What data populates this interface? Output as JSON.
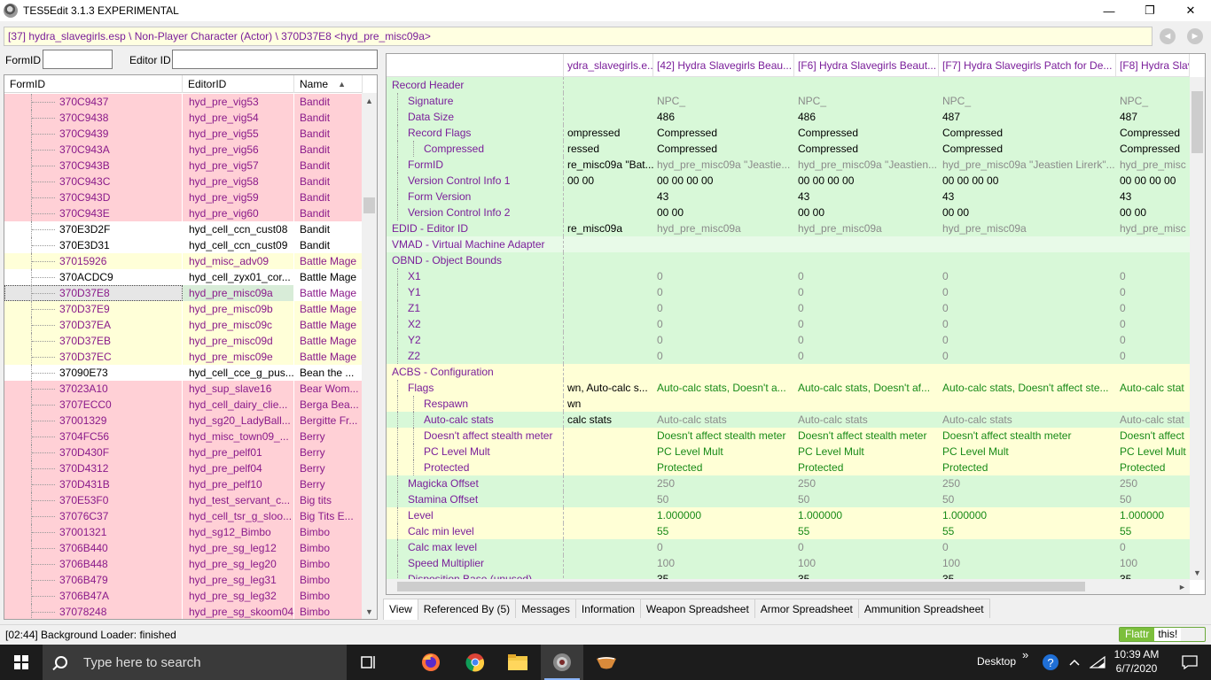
{
  "window": {
    "title": "TES5Edit 3.1.3 EXPERIMENTAL",
    "minimize": "—",
    "restore": "❐",
    "close": "✕"
  },
  "path": "[37] hydra_slavegirls.esp \\ Non-Player Character (Actor) \\ 370D37E8 <hyd_pre_misc09a>",
  "nav": {
    "back": "◄",
    "forward": "►"
  },
  "filter": {
    "formid_label": "FormID",
    "editorid_label": "Editor ID",
    "formid_value": "",
    "editorid_value": ""
  },
  "left_list": {
    "headers": [
      "FormID",
      "EditorID",
      "Name"
    ],
    "sort_indicator": "▲",
    "rows": [
      {
        "formid": "370C9437",
        "editorid": "hyd_pre_vig53",
        "name": "Bandit",
        "color": "pink"
      },
      {
        "formid": "370C9438",
        "editorid": "hyd_pre_vig54",
        "name": "Bandit",
        "color": "pink"
      },
      {
        "formid": "370C9439",
        "editorid": "hyd_pre_vig55",
        "name": "Bandit",
        "color": "pink"
      },
      {
        "formid": "370C943A",
        "editorid": "hyd_pre_vig56",
        "name": "Bandit",
        "color": "pink"
      },
      {
        "formid": "370C943B",
        "editorid": "hyd_pre_vig57",
        "name": "Bandit",
        "color": "pink"
      },
      {
        "formid": "370C943C",
        "editorid": "hyd_pre_vig58",
        "name": "Bandit",
        "color": "pink"
      },
      {
        "formid": "370C943D",
        "editorid": "hyd_pre_vig59",
        "name": "Bandit",
        "color": "pink"
      },
      {
        "formid": "370C943E",
        "editorid": "hyd_pre_vig60",
        "name": "Bandit",
        "color": "pink"
      },
      {
        "formid": "370E3D2F",
        "editorid": "hyd_cell_ccn_cust08",
        "name": "Bandit",
        "color": "white"
      },
      {
        "formid": "370E3D31",
        "editorid": "hyd_cell_ccn_cust09",
        "name": "Bandit",
        "color": "white"
      },
      {
        "formid": "37015926",
        "editorid": "hyd_misc_adv09",
        "name": "Battle Mage",
        "color": "yellow"
      },
      {
        "formid": "370ACDC9",
        "editorid": "hyd_cell_zyx01_cor...",
        "name": "Battle Mage",
        "color": "white"
      },
      {
        "formid": "370D37E8",
        "editorid": "hyd_pre_misc09a",
        "name": "Battle Mage",
        "color": "selected"
      },
      {
        "formid": "370D37E9",
        "editorid": "hyd_pre_misc09b",
        "name": "Battle Mage",
        "color": "yellow"
      },
      {
        "formid": "370D37EA",
        "editorid": "hyd_pre_misc09c",
        "name": "Battle Mage",
        "color": "yellow"
      },
      {
        "formid": "370D37EB",
        "editorid": "hyd_pre_misc09d",
        "name": "Battle Mage",
        "color": "yellow"
      },
      {
        "formid": "370D37EC",
        "editorid": "hyd_pre_misc09e",
        "name": "Battle Mage",
        "color": "yellow"
      },
      {
        "formid": "37090E73",
        "editorid": "hyd_cell_cce_g_pus...",
        "name": "Bean the ...",
        "color": "white"
      },
      {
        "formid": "37023A10",
        "editorid": "hyd_sup_slave16",
        "name": "Bear Wom...",
        "color": "pink"
      },
      {
        "formid": "3707ECC0",
        "editorid": "hyd_cell_dairy_clie...",
        "name": "Berga Bea...",
        "color": "pink"
      },
      {
        "formid": "37001329",
        "editorid": "hyd_sg20_LadyBall...",
        "name": "Bergitte Fr...",
        "color": "pink"
      },
      {
        "formid": "3704FC56",
        "editorid": "hyd_misc_town09_...",
        "name": "Berry",
        "color": "pink"
      },
      {
        "formid": "370D430F",
        "editorid": "hyd_pre_pelf01",
        "name": "Berry",
        "color": "pink"
      },
      {
        "formid": "370D4312",
        "editorid": "hyd_pre_pelf04",
        "name": "Berry",
        "color": "pink"
      },
      {
        "formid": "370D431B",
        "editorid": "hyd_pre_pelf10",
        "name": "Berry",
        "color": "pink"
      },
      {
        "formid": "370E53F0",
        "editorid": "hyd_test_servant_c...",
        "name": "Big tits",
        "color": "pink"
      },
      {
        "formid": "37076C37",
        "editorid": "hyd_cell_tsr_g_sloo...",
        "name": "Big Tits E...",
        "color": "pink"
      },
      {
        "formid": "37001321",
        "editorid": "hyd_sg12_Bimbo",
        "name": "Bimbo",
        "color": "pink"
      },
      {
        "formid": "3706B440",
        "editorid": "hyd_pre_sg_leg12",
        "name": "Bimbo",
        "color": "pink"
      },
      {
        "formid": "3706B448",
        "editorid": "hyd_pre_sg_leg20",
        "name": "Bimbo",
        "color": "pink"
      },
      {
        "formid": "3706B479",
        "editorid": "hyd_pre_sg_leg31",
        "name": "Bimbo",
        "color": "pink"
      },
      {
        "formid": "3706B47A",
        "editorid": "hyd_pre_sg_leg32",
        "name": "Bimbo",
        "color": "pink"
      },
      {
        "formid": "37078248",
        "editorid": "hyd_pre_sg_skoom04",
        "name": "Bimbo",
        "color": "pink"
      }
    ]
  },
  "record_view": {
    "headers": [
      "",
      "ydra_slavegirls.e...",
      "[42] Hydra Slavegirls Beau...",
      "[F6] Hydra Slavegirls Beaut...",
      "[F7] Hydra Slavegirls Patch for De...",
      "[F8] Hydra Slaveg"
    ],
    "rows": [
      {
        "label": "Record Header",
        "level": 0,
        "bg": "g",
        "cls": "",
        "cells": [
          "",
          "",
          "",
          "",
          ""
        ]
      },
      {
        "label": "Signature",
        "level": 1,
        "bg": "g",
        "cls": "gray",
        "cells": [
          "",
          "NPC_",
          "NPC_",
          "NPC_",
          "NPC_"
        ]
      },
      {
        "label": "Data Size",
        "level": 1,
        "bg": "g",
        "cls": "black",
        "cells": [
          "",
          "486",
          "486",
          "487",
          "487"
        ]
      },
      {
        "label": "Record Flags",
        "level": 1,
        "bg": "g",
        "cls": "black",
        "cells": [
          "ompressed",
          "Compressed",
          "Compressed",
          "Compressed",
          "Compressed"
        ]
      },
      {
        "label": "Compressed",
        "level": 2,
        "bg": "g",
        "cls": "black",
        "cells": [
          "ressed",
          "Compressed",
          "Compressed",
          "Compressed",
          "Compressed"
        ]
      },
      {
        "label": "FormID",
        "level": 1,
        "bg": "g",
        "cls": "gray",
        "cells": [
          "re_misc09a \"Bat...",
          "hyd_pre_misc09a \"Jeastie...",
          "hyd_pre_misc09a \"Jeastien...",
          "hyd_pre_misc09a \"Jeastien Lirerk\"...",
          "hyd_pre_misc"
        ]
      },
      {
        "label": "Version Control Info 1",
        "level": 1,
        "bg": "g",
        "cls": "black",
        "cells": [
          "00 00",
          "00 00 00 00",
          "00 00 00 00",
          "00 00 00 00",
          "00 00 00 00"
        ]
      },
      {
        "label": "Form Version",
        "level": 1,
        "bg": "g",
        "cls": "black",
        "cells": [
          "",
          "43",
          "43",
          "43",
          "43"
        ]
      },
      {
        "label": "Version Control Info 2",
        "level": 1,
        "bg": "g",
        "cls": "black",
        "cells": [
          "",
          "00 00",
          "00 00",
          "00 00",
          "00 00"
        ]
      },
      {
        "label": "EDID - Editor ID",
        "level": 0,
        "bg": "g",
        "cls": "gray",
        "cells": [
          "re_misc09a",
          "hyd_pre_misc09a",
          "hyd_pre_misc09a",
          "hyd_pre_misc09a",
          "hyd_pre_misc"
        ]
      },
      {
        "label": "VMAD - Virtual Machine Adapter",
        "level": 0,
        "bg": "gl",
        "cls": "dim",
        "cells": [
          "",
          "",
          "",
          "",
          ""
        ]
      },
      {
        "label": "OBND - Object Bounds",
        "level": 0,
        "bg": "g",
        "cls": "",
        "cells": [
          "",
          "",
          "",
          "",
          ""
        ]
      },
      {
        "label": "X1",
        "level": 1,
        "bg": "g",
        "cls": "gray",
        "cells": [
          "",
          "0",
          "0",
          "0",
          "0"
        ]
      },
      {
        "label": "Y1",
        "level": 1,
        "bg": "g",
        "cls": "gray",
        "cells": [
          "",
          "0",
          "0",
          "0",
          "0"
        ]
      },
      {
        "label": "Z1",
        "level": 1,
        "bg": "g",
        "cls": "gray",
        "cells": [
          "",
          "0",
          "0",
          "0",
          "0"
        ]
      },
      {
        "label": "X2",
        "level": 1,
        "bg": "g",
        "cls": "gray",
        "cells": [
          "",
          "0",
          "0",
          "0",
          "0"
        ]
      },
      {
        "label": "Y2",
        "level": 1,
        "bg": "g",
        "cls": "gray",
        "cells": [
          "",
          "0",
          "0",
          "0",
          "0"
        ]
      },
      {
        "label": "Z2",
        "level": 1,
        "bg": "g",
        "cls": "gray",
        "cells": [
          "",
          "0",
          "0",
          "0",
          "0"
        ]
      },
      {
        "label": "ACBS - Configuration",
        "level": 0,
        "bg": "y",
        "cls": "",
        "cells": [
          "",
          "",
          "",
          "",
          ""
        ]
      },
      {
        "label": "Flags",
        "level": 1,
        "bg": "y",
        "cls": "green",
        "cells": [
          "wn, Auto-calc s...",
          "Auto-calc stats, Doesn't a...",
          "Auto-calc stats, Doesn't af...",
          "Auto-calc stats, Doesn't affect ste...",
          "Auto-calc stat"
        ]
      },
      {
        "label": "Respawn",
        "level": 2,
        "bg": "y",
        "cls": "black",
        "cells": [
          "wn",
          "",
          "",
          "",
          ""
        ]
      },
      {
        "label": "Auto-calc stats",
        "level": 2,
        "bg": "g",
        "cls": "gray",
        "cells": [
          "calc stats",
          "Auto-calc stats",
          "Auto-calc stats",
          "Auto-calc stats",
          "Auto-calc stat"
        ]
      },
      {
        "label": "Doesn't affect stealth meter",
        "level": 2,
        "bg": "y",
        "cls": "green",
        "cells": [
          "",
          "Doesn't affect stealth meter",
          "Doesn't affect stealth meter",
          "Doesn't affect stealth meter",
          "Doesn't affect"
        ]
      },
      {
        "label": "PC Level Mult",
        "level": 2,
        "bg": "y",
        "cls": "green",
        "cells": [
          "",
          "PC Level Mult",
          "PC Level Mult",
          "PC Level Mult",
          "PC Level Mult"
        ]
      },
      {
        "label": "Protected",
        "level": 2,
        "bg": "y",
        "cls": "green",
        "cells": [
          "",
          "Protected",
          "Protected",
          "Protected",
          "Protected"
        ]
      },
      {
        "label": "Magicka Offset",
        "level": 1,
        "bg": "g",
        "cls": "gray",
        "cells": [
          "",
          "250",
          "250",
          "250",
          "250"
        ]
      },
      {
        "label": "Stamina Offset",
        "level": 1,
        "bg": "g",
        "cls": "gray",
        "cells": [
          "",
          "50",
          "50",
          "50",
          "50"
        ]
      },
      {
        "label": "Level",
        "level": 1,
        "bg": "y",
        "cls": "green",
        "cells": [
          "",
          "1.000000",
          "1.000000",
          "1.000000",
          "1.000000"
        ]
      },
      {
        "label": "Calc min level",
        "level": 1,
        "bg": "y",
        "cls": "green",
        "cells": [
          "",
          "55",
          "55",
          "55",
          "55"
        ]
      },
      {
        "label": "Calc max level",
        "level": 1,
        "bg": "g",
        "cls": "gray",
        "cells": [
          "",
          "0",
          "0",
          "0",
          "0"
        ]
      },
      {
        "label": "Speed Multiplier",
        "level": 1,
        "bg": "g",
        "cls": "gray",
        "cells": [
          "",
          "100",
          "100",
          "100",
          "100"
        ]
      },
      {
        "label": "Disposition Base (unused)",
        "level": 1,
        "bg": "g",
        "cls": "black",
        "cells": [
          "",
          "35",
          "35",
          "35",
          "35"
        ]
      }
    ]
  },
  "tabs": [
    "View",
    "Referenced By (5)",
    "Messages",
    "Information",
    "Weapon Spreadsheet",
    "Armor Spreadsheet",
    "Ammunition Spreadsheet"
  ],
  "status": {
    "text": "[02:44] Background Loader: finished",
    "flattr_a": "Flattr",
    "flattr_b": "this!"
  },
  "taskbar": {
    "search_placeholder": "Type here to search",
    "desktop_label": "Desktop",
    "tray_chevron": "»",
    "time": "10:39 AM",
    "date": "6/7/2020"
  }
}
